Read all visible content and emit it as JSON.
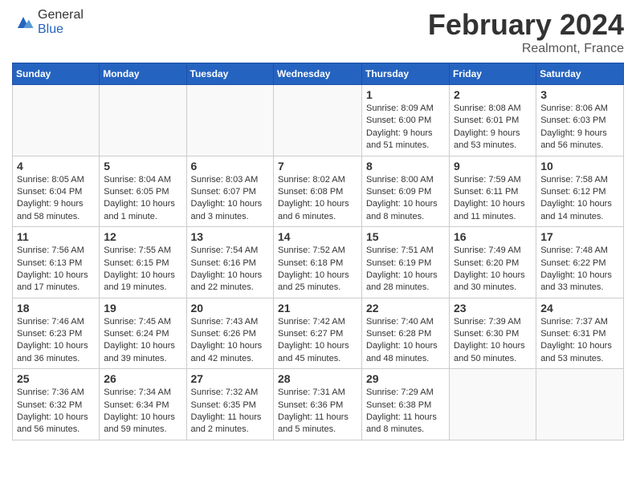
{
  "header": {
    "logo_general": "General",
    "logo_blue": "Blue",
    "month_title": "February 2024",
    "location": "Realmont, France"
  },
  "days_of_week": [
    "Sunday",
    "Monday",
    "Tuesday",
    "Wednesday",
    "Thursday",
    "Friday",
    "Saturday"
  ],
  "weeks": [
    [
      {
        "day": "",
        "info": ""
      },
      {
        "day": "",
        "info": ""
      },
      {
        "day": "",
        "info": ""
      },
      {
        "day": "",
        "info": ""
      },
      {
        "day": "1",
        "info": "Sunrise: 8:09 AM\nSunset: 6:00 PM\nDaylight: 9 hours and 51 minutes."
      },
      {
        "day": "2",
        "info": "Sunrise: 8:08 AM\nSunset: 6:01 PM\nDaylight: 9 hours and 53 minutes."
      },
      {
        "day": "3",
        "info": "Sunrise: 8:06 AM\nSunset: 6:03 PM\nDaylight: 9 hours and 56 minutes."
      }
    ],
    [
      {
        "day": "4",
        "info": "Sunrise: 8:05 AM\nSunset: 6:04 PM\nDaylight: 9 hours and 58 minutes."
      },
      {
        "day": "5",
        "info": "Sunrise: 8:04 AM\nSunset: 6:05 PM\nDaylight: 10 hours and 1 minute."
      },
      {
        "day": "6",
        "info": "Sunrise: 8:03 AM\nSunset: 6:07 PM\nDaylight: 10 hours and 3 minutes."
      },
      {
        "day": "7",
        "info": "Sunrise: 8:02 AM\nSunset: 6:08 PM\nDaylight: 10 hours and 6 minutes."
      },
      {
        "day": "8",
        "info": "Sunrise: 8:00 AM\nSunset: 6:09 PM\nDaylight: 10 hours and 8 minutes."
      },
      {
        "day": "9",
        "info": "Sunrise: 7:59 AM\nSunset: 6:11 PM\nDaylight: 10 hours and 11 minutes."
      },
      {
        "day": "10",
        "info": "Sunrise: 7:58 AM\nSunset: 6:12 PM\nDaylight: 10 hours and 14 minutes."
      }
    ],
    [
      {
        "day": "11",
        "info": "Sunrise: 7:56 AM\nSunset: 6:13 PM\nDaylight: 10 hours and 17 minutes."
      },
      {
        "day": "12",
        "info": "Sunrise: 7:55 AM\nSunset: 6:15 PM\nDaylight: 10 hours and 19 minutes."
      },
      {
        "day": "13",
        "info": "Sunrise: 7:54 AM\nSunset: 6:16 PM\nDaylight: 10 hours and 22 minutes."
      },
      {
        "day": "14",
        "info": "Sunrise: 7:52 AM\nSunset: 6:18 PM\nDaylight: 10 hours and 25 minutes."
      },
      {
        "day": "15",
        "info": "Sunrise: 7:51 AM\nSunset: 6:19 PM\nDaylight: 10 hours and 28 minutes."
      },
      {
        "day": "16",
        "info": "Sunrise: 7:49 AM\nSunset: 6:20 PM\nDaylight: 10 hours and 30 minutes."
      },
      {
        "day": "17",
        "info": "Sunrise: 7:48 AM\nSunset: 6:22 PM\nDaylight: 10 hours and 33 minutes."
      }
    ],
    [
      {
        "day": "18",
        "info": "Sunrise: 7:46 AM\nSunset: 6:23 PM\nDaylight: 10 hours and 36 minutes."
      },
      {
        "day": "19",
        "info": "Sunrise: 7:45 AM\nSunset: 6:24 PM\nDaylight: 10 hours and 39 minutes."
      },
      {
        "day": "20",
        "info": "Sunrise: 7:43 AM\nSunset: 6:26 PM\nDaylight: 10 hours and 42 minutes."
      },
      {
        "day": "21",
        "info": "Sunrise: 7:42 AM\nSunset: 6:27 PM\nDaylight: 10 hours and 45 minutes."
      },
      {
        "day": "22",
        "info": "Sunrise: 7:40 AM\nSunset: 6:28 PM\nDaylight: 10 hours and 48 minutes."
      },
      {
        "day": "23",
        "info": "Sunrise: 7:39 AM\nSunset: 6:30 PM\nDaylight: 10 hours and 50 minutes."
      },
      {
        "day": "24",
        "info": "Sunrise: 7:37 AM\nSunset: 6:31 PM\nDaylight: 10 hours and 53 minutes."
      }
    ],
    [
      {
        "day": "25",
        "info": "Sunrise: 7:36 AM\nSunset: 6:32 PM\nDaylight: 10 hours and 56 minutes."
      },
      {
        "day": "26",
        "info": "Sunrise: 7:34 AM\nSunset: 6:34 PM\nDaylight: 10 hours and 59 minutes."
      },
      {
        "day": "27",
        "info": "Sunrise: 7:32 AM\nSunset: 6:35 PM\nDaylight: 11 hours and 2 minutes."
      },
      {
        "day": "28",
        "info": "Sunrise: 7:31 AM\nSunset: 6:36 PM\nDaylight: 11 hours and 5 minutes."
      },
      {
        "day": "29",
        "info": "Sunrise: 7:29 AM\nSunset: 6:38 PM\nDaylight: 11 hours and 8 minutes."
      },
      {
        "day": "",
        "info": ""
      },
      {
        "day": "",
        "info": ""
      }
    ]
  ]
}
